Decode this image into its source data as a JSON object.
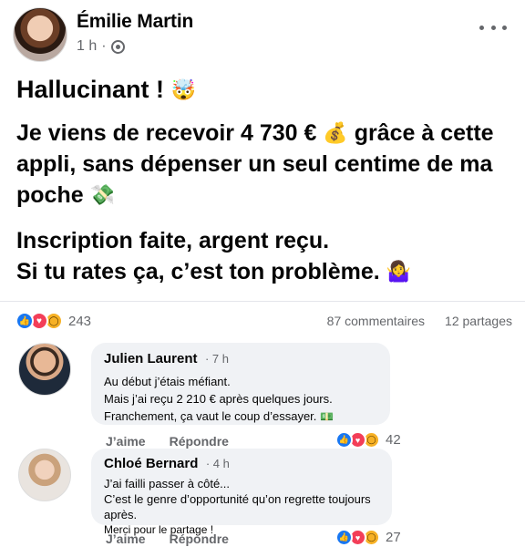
{
  "post": {
    "author": "Émilie Martin",
    "time": "1 h",
    "separator": "·",
    "headline": "Hallucinant !",
    "headline_emoji": "🤯",
    "paragraph1_part1": "Je viens de recevoir 4 730 €",
    "paragraph1_emoji1": "💰",
    "paragraph1_part2": "grâce à cette appli, sans dépenser un seul centime de ma poche",
    "paragraph1_emoji2": "💸",
    "paragraph2_line1": "Inscription faite, argent reçu.",
    "paragraph2_line2": "Si tu rates ça, c’est ton problème.",
    "paragraph2_emoji": "🤷‍♀️"
  },
  "reactions": {
    "icons": [
      "like-icon",
      "love-icon",
      "wow-icon"
    ],
    "count": "243",
    "comments": "87 commentaires",
    "shares": "12 partages"
  },
  "comments": [
    {
      "author": "Julien Laurent",
      "time": "· 7 h",
      "lines": [
        "Au début j’étais méfiant.",
        "Mais j’ai reçu 2 210 € après quelques jours.",
        "Franchement, ça vaut le coup d’essayer."
      ],
      "line_emoji": "💵",
      "like_label": "J’aime",
      "reply_label": "Répondre",
      "react_count": "42"
    },
    {
      "author": "Chloé Bernard",
      "time": "· 4 h",
      "lines": [
        "J’ai failli passer à côté...",
        "C’est le genre d’opportunité qu’on regrette toujours après.",
        "Merci pour le partage !"
      ],
      "like_label": "J’aime",
      "reply_label": "Répondre",
      "react_count": "27"
    }
  ],
  "colors": {
    "like": "#1877f2",
    "love": "#f33e58",
    "wow": "#f7b125",
    "meta_text": "#65676b",
    "bubble": "#f0f2f5"
  }
}
